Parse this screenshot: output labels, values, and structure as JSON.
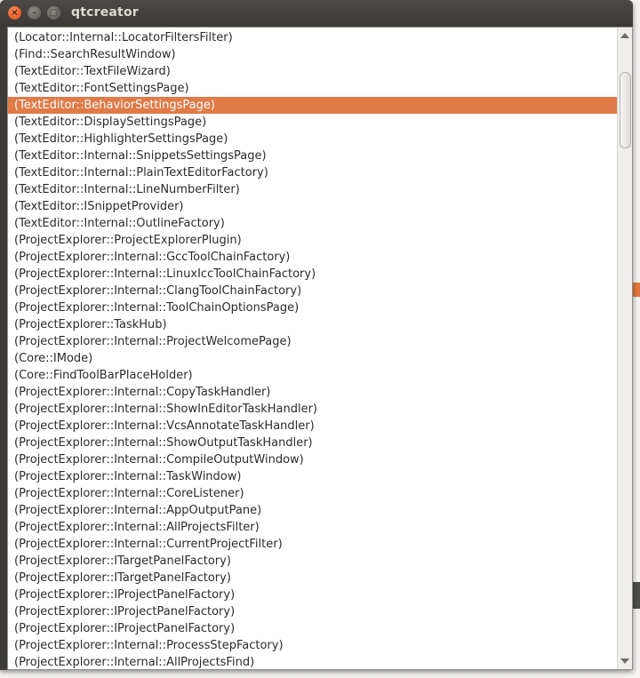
{
  "window": {
    "title": "qtcreator",
    "buttons": {
      "close": "×",
      "minimize": "–",
      "maximize": "□"
    }
  },
  "list": {
    "selected_index": 4,
    "items": [
      "(Locator::Internal::LocatorFiltersFilter)",
      "(Find::SearchResultWindow)",
      "(TextEditor::TextFileWizard)",
      "(TextEditor::FontSettingsPage)",
      "(TextEditor::BehaviorSettingsPage)",
      "(TextEditor::DisplaySettingsPage)",
      "(TextEditor::HighlighterSettingsPage)",
      "(TextEditor::Internal::SnippetsSettingsPage)",
      "(TextEditor::Internal::PlainTextEditorFactory)",
      "(TextEditor::Internal::LineNumberFilter)",
      "(TextEditor::ISnippetProvider)",
      "(TextEditor::Internal::OutlineFactory)",
      "(ProjectExplorer::ProjectExplorerPlugin)",
      "(ProjectExplorer::Internal::GccToolChainFactory)",
      "(ProjectExplorer::Internal::LinuxIccToolChainFactory)",
      "(ProjectExplorer::Internal::ClangToolChainFactory)",
      "(ProjectExplorer::Internal::ToolChainOptionsPage)",
      "(ProjectExplorer::TaskHub)",
      "(ProjectExplorer::Internal::ProjectWelcomePage)",
      "(Core::IMode)",
      "(Core::FindToolBarPlaceHolder)",
      "(ProjectExplorer::Internal::CopyTaskHandler)",
      "(ProjectExplorer::Internal::ShowInEditorTaskHandler)",
      "(ProjectExplorer::Internal::VcsAnnotateTaskHandler)",
      "(ProjectExplorer::Internal::ShowOutputTaskHandler)",
      "(ProjectExplorer::Internal::CompileOutputWindow)",
      "(ProjectExplorer::Internal::TaskWindow)",
      "(ProjectExplorer::Internal::CoreListener)",
      "(ProjectExplorer::Internal::AppOutputPane)",
      "(ProjectExplorer::Internal::AllProjectsFilter)",
      "(ProjectExplorer::Internal::CurrentProjectFilter)",
      "(ProjectExplorer::ITargetPanelFactory)",
      "(ProjectExplorer::ITargetPanelFactory)",
      "(ProjectExplorer::IProjectPanelFactory)",
      "(ProjectExplorer::IProjectPanelFactory)",
      "(ProjectExplorer::IProjectPanelFactory)",
      "(ProjectExplorer::Internal::ProcessStepFactory)",
      "(ProjectExplorer::Internal::AllProjectsFind)"
    ]
  },
  "colors": {
    "selection": "#e07a47",
    "titlebar": "#3c3b37",
    "title_text": "#dfdbd2"
  }
}
